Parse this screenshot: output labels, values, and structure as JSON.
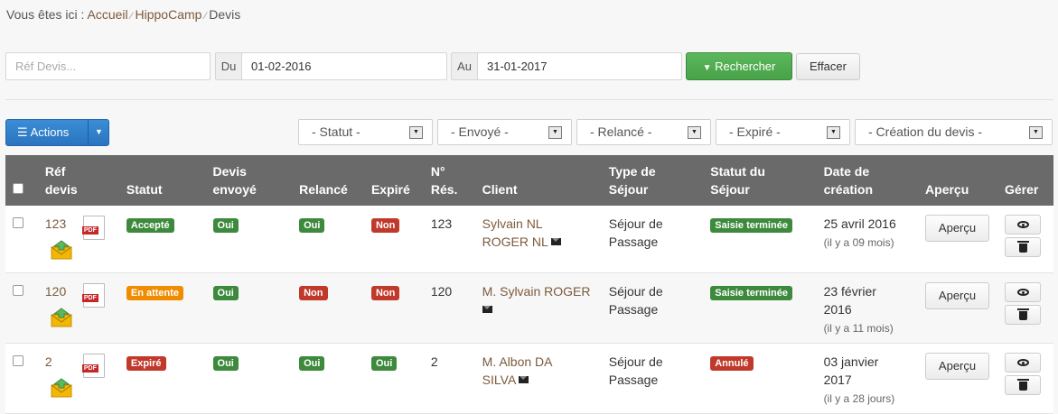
{
  "breadcrumb": {
    "prefix": "Vous êtes ici :",
    "items": [
      "Accueil",
      "HippoCamp",
      "Devis"
    ]
  },
  "search": {
    "ref_placeholder": "Réf Devis...",
    "from_label": "Du",
    "from_value": "01-02-2016",
    "to_label": "Au",
    "to_value": "31-01-2017",
    "search_button": "Rechercher",
    "clear_button": "Effacer"
  },
  "actions": {
    "label": "Actions"
  },
  "filters": {
    "statut": "- Statut -",
    "envoye": "- Envoyé -",
    "relance": "- Relancé -",
    "expire": "- Expiré -",
    "creation": "- Création du devis -"
  },
  "colors": {
    "accent_green": "#5cb85c",
    "accent_blue": "#2a74bf",
    "header_bg": "#6a6a6a",
    "badge_green": "#3d8a3d",
    "badge_red": "#c0392b",
    "badge_orange": "#f08c00",
    "link": "#7d5a3c"
  },
  "table": {
    "headers": {
      "ref": [
        "Réf",
        "devis"
      ],
      "statut": "Statut",
      "envoye": [
        "Devis",
        "envoyé"
      ],
      "relance": "Relancé",
      "expire": "Expiré",
      "nres": [
        "N°",
        "Rés."
      ],
      "client": "Client",
      "type": [
        "Type de",
        "Séjour"
      ],
      "statut_sejour": [
        "Statut du",
        "Séjour"
      ],
      "date": [
        "Date de",
        "création"
      ],
      "apercu": "Aperçu",
      "gerer": "Gérer"
    },
    "rows": [
      {
        "ref": "123",
        "pdf": "PDF",
        "statut": "Accepté",
        "envoye": "Oui",
        "relance": "Oui",
        "expire": "Non",
        "nres": "123",
        "client_line1": "Sylvain NL",
        "client_line2": "ROGER NL",
        "type_line1": "Séjour de",
        "type_line2": "Passage",
        "statut_sejour": "Saisie terminée",
        "date_line1": "25 avril 2016",
        "date_line2": "",
        "date_rel": "(il y a 09 mois)",
        "apercu": "Aperçu"
      },
      {
        "ref": "120",
        "pdf": "PDF",
        "statut": "En attente",
        "envoye": "Oui",
        "relance": "Non",
        "expire": "Non",
        "nres": "120",
        "client_line1": "M. Sylvain ROGER",
        "client_line2": "",
        "type_line1": "Séjour de",
        "type_line2": "Passage",
        "statut_sejour": "Saisie terminée",
        "date_line1": "23 février",
        "date_line2": "2016",
        "date_rel": "(il y a 11 mois)",
        "apercu": "Aperçu"
      },
      {
        "ref": "2",
        "pdf": "PDF",
        "statut": "Expiré",
        "envoye": "Oui",
        "relance": "Oui",
        "expire": "Oui",
        "nres": "2",
        "client_line1": "M. Albon DA",
        "client_line2": "SILVA",
        "type_line1": "Séjour de",
        "type_line2": "Passage",
        "statut_sejour": "Annulé",
        "date_line1": "03 janvier",
        "date_line2": "2017",
        "date_rel": "(il y a 28 jours)",
        "apercu": "Aperçu"
      }
    ]
  }
}
